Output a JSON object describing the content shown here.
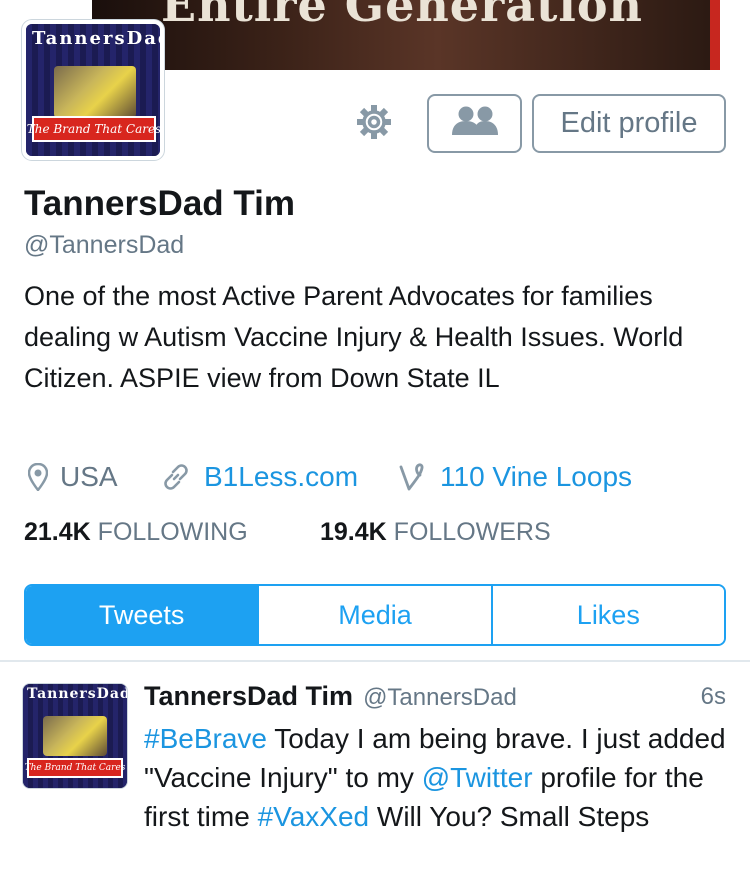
{
  "banner": {
    "title": "Entire Generation"
  },
  "avatar": {
    "arc_text": "TannersDad",
    "banner_text": "The Brand That Cares"
  },
  "actions": {
    "settings_icon": "gear-icon",
    "people_icon": "people-icon",
    "edit_profile": "Edit profile"
  },
  "profile": {
    "name": "TannersDad Tim",
    "handle": "@TannersDad",
    "bio": "One of the most Active Parent Advocates for families dealing w Autism Vaccine Injury & Health Issues. World Citizen. ASPIE view from Down State IL",
    "location": "USA",
    "website": "B1Less.com",
    "vine": "110 Vine Loops",
    "following_count": "21.4K",
    "following_label": "FOLLOWING",
    "followers_count": "19.4K",
    "followers_label": "FOLLOWERS"
  },
  "tabs": [
    {
      "label": "Tweets",
      "active": true
    },
    {
      "label": "Media",
      "active": false
    },
    {
      "label": "Likes",
      "active": false
    }
  ],
  "tweet": {
    "name": "TannersDad Tim",
    "handle": "@TannersDad",
    "time": "6s",
    "parts": {
      "hashtag1": "#BeBrave",
      "text1": " Today I am being brave. I just added \"Vaccine Injury\" to my ",
      "mention": "@Twitter",
      "text2": " profile for the first time ",
      "hashtag2": "#VaxXed",
      "text3": " Will You? Small Steps"
    }
  },
  "colors": {
    "accent": "#1da1f2",
    "link": "#1b95e0",
    "muted": "#657786",
    "text": "#14171a"
  }
}
